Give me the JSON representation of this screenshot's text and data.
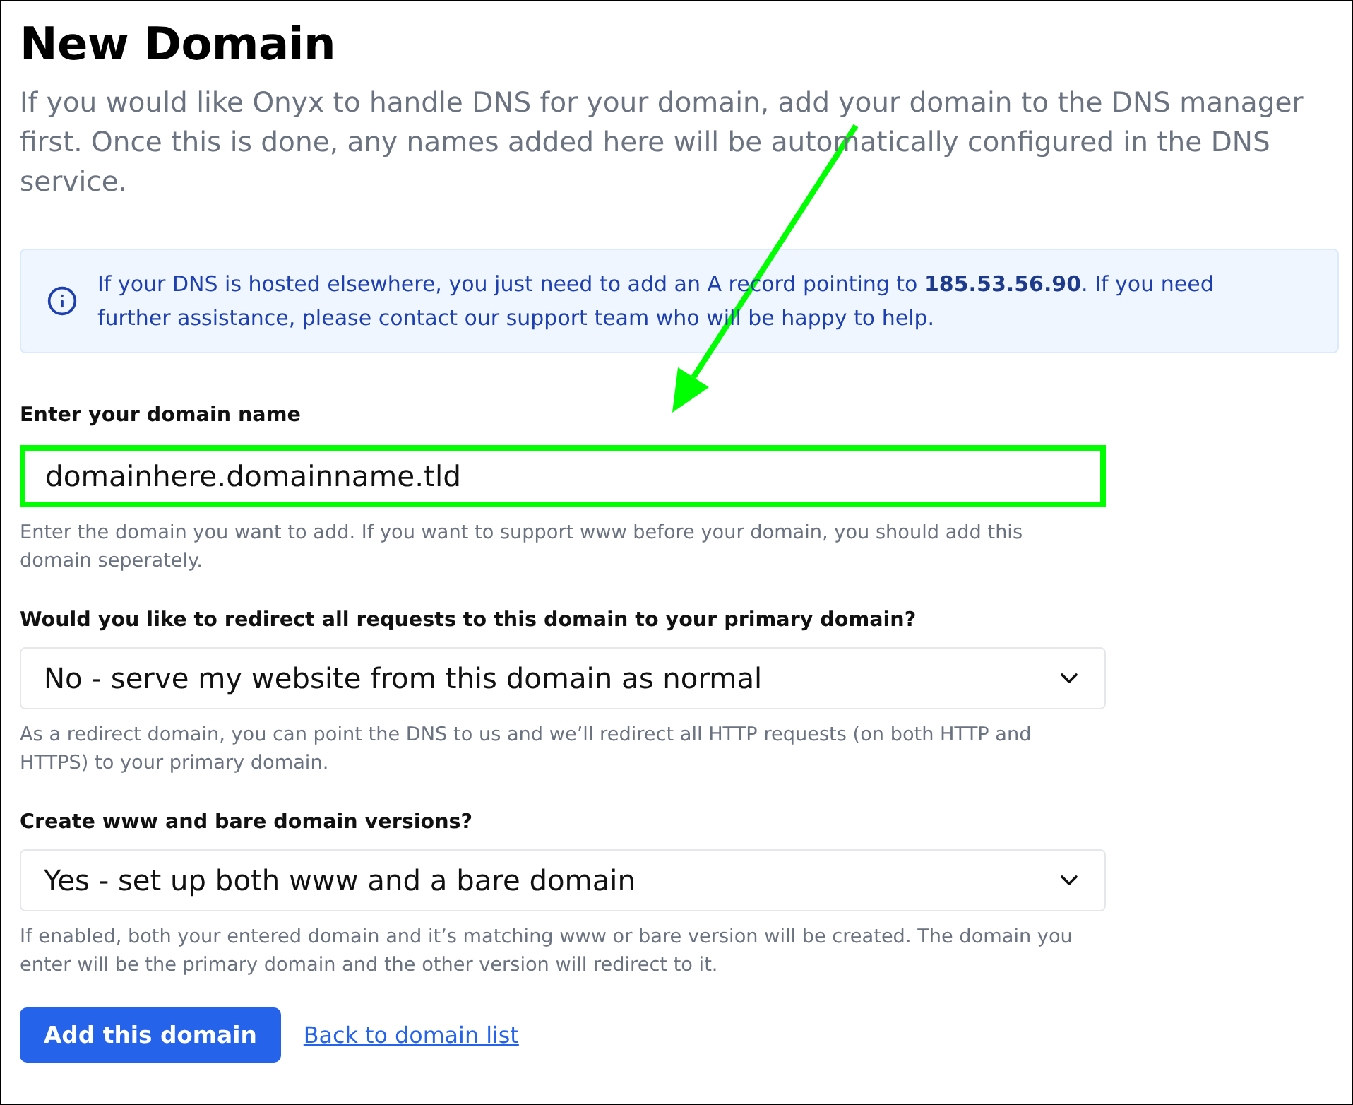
{
  "page": {
    "title": "New Domain",
    "description": "If you would like Onyx to handle DNS for your domain, add your domain to the DNS manager first. Once this is done, any names added here will be automatically configured in the DNS service."
  },
  "notice": {
    "text": "If your DNS is hosted elsewhere, you just need to add an A record pointing to **185.53.56.90**. If you need further assistance, please contact our support team who will be happy to help."
  },
  "fields": [
    {
      "kind": "text",
      "label": "Enter your domain name",
      "value": "domainhere.domainname.tld",
      "highlighted": true,
      "help": "Enter the domain you want to add. If you want to support www before your domain, you should add this domain seperately."
    },
    {
      "kind": "select",
      "label": "Would you like to redirect all requests to this domain to your primary domain?",
      "value": "No - serve my website from this domain as normal",
      "help": "As a redirect domain, you can point the DNS to us and we’ll redirect all HTTP requests (on both HTTP and HTTPS) to your primary domain."
    },
    {
      "kind": "select",
      "label": "Create www and bare domain versions?",
      "value": "Yes - set up both www and a bare domain",
      "help": "If enabled, both your entered domain and it’s matching www or bare version will be created. The domain you enter will be the primary domain and the other version will redirect to it."
    }
  ],
  "actions": {
    "submit": "Add this domain",
    "link": "Back to domain list"
  }
}
